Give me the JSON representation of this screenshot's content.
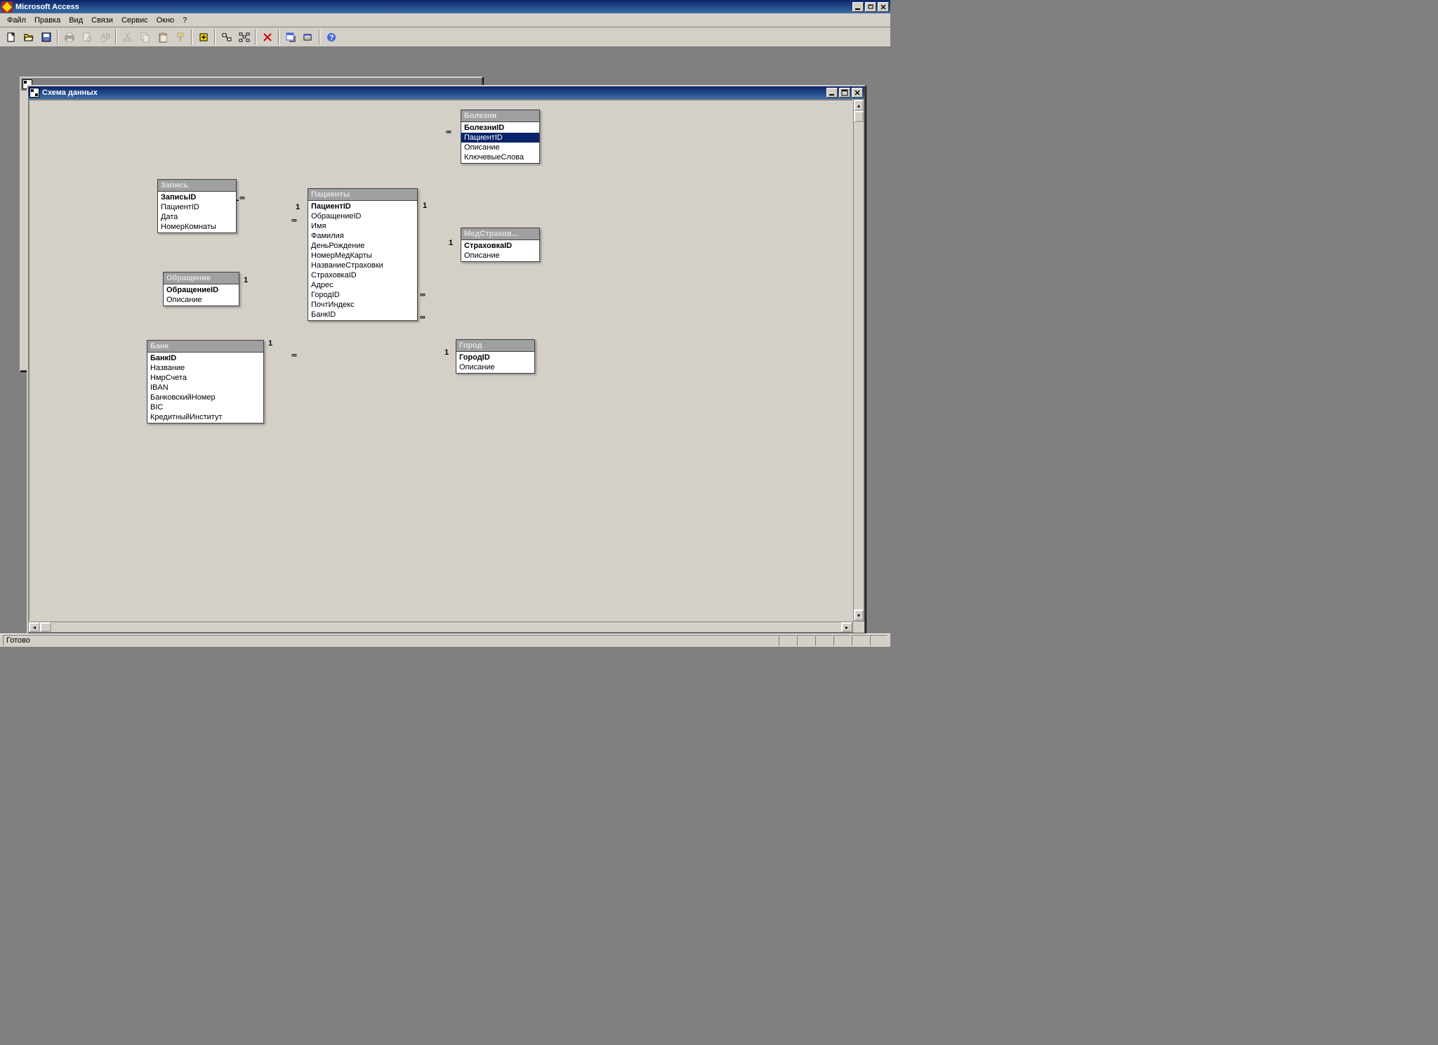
{
  "app": {
    "title": "Microsoft Access"
  },
  "menu": {
    "items": [
      "Файл",
      "Правка",
      "Вид",
      "Связи",
      "Сервис",
      "Окно",
      "?"
    ]
  },
  "toolbar": {
    "icons": [
      "new",
      "open",
      "save",
      "print",
      "preview",
      "spelling",
      "cut",
      "copy",
      "paste",
      "format-painter",
      "new-object",
      "table-show",
      "table-all",
      "delete",
      "office-links",
      "analyze",
      "help"
    ]
  },
  "child_window": {
    "title": "Схема данных"
  },
  "tables": {
    "zapis": {
      "title": "Запись",
      "fields": [
        {
          "n": "ЗаписьID",
          "pk": true
        },
        {
          "n": "ПациентID"
        },
        {
          "n": "Дата"
        },
        {
          "n": "НомерКомнаты"
        }
      ]
    },
    "obrash": {
      "title": "Обращение",
      "fields": [
        {
          "n": "ОбращениеID",
          "pk": true
        },
        {
          "n": "Описание"
        }
      ]
    },
    "bank": {
      "title": "Банк",
      "fields": [
        {
          "n": "БанкID",
          "pk": true
        },
        {
          "n": "Название"
        },
        {
          "n": "НмрСчета"
        },
        {
          "n": "IBAN"
        },
        {
          "n": "БанковскийНомер"
        },
        {
          "n": "BIC"
        },
        {
          "n": "КредитныйИнститут"
        }
      ]
    },
    "patients": {
      "title": "Пациенты",
      "fields": [
        {
          "n": "ПациентID",
          "pk": true
        },
        {
          "n": "ОбращениеID"
        },
        {
          "n": "Имя"
        },
        {
          "n": "Фамилия"
        },
        {
          "n": "ДеньРождение"
        },
        {
          "n": "НомерМедКарты"
        },
        {
          "n": "НазваниеСтраховки"
        },
        {
          "n": "СтраховкаID"
        },
        {
          "n": "Адрес"
        },
        {
          "n": "ГородID"
        },
        {
          "n": "ПочтИндекс"
        },
        {
          "n": "БанкID"
        }
      ]
    },
    "bolezni": {
      "title": "Болезни",
      "fields": [
        {
          "n": "БолезниID",
          "pk": true
        },
        {
          "n": "ПациентID",
          "selected": true
        },
        {
          "n": "Описание"
        },
        {
          "n": "КлючевыеСлова"
        }
      ]
    },
    "medstrah": {
      "title": "МедСтрахов...",
      "fields": [
        {
          "n": "СтраховкаID",
          "pk": true
        },
        {
          "n": "Описание"
        }
      ]
    },
    "gorod": {
      "title": "Город",
      "fields": [
        {
          "n": "ГородID",
          "pk": true
        },
        {
          "n": "Описание"
        }
      ]
    }
  },
  "relations": {
    "labels": {
      "one": "1",
      "many": "∞"
    }
  },
  "status": {
    "text": "Готово"
  }
}
